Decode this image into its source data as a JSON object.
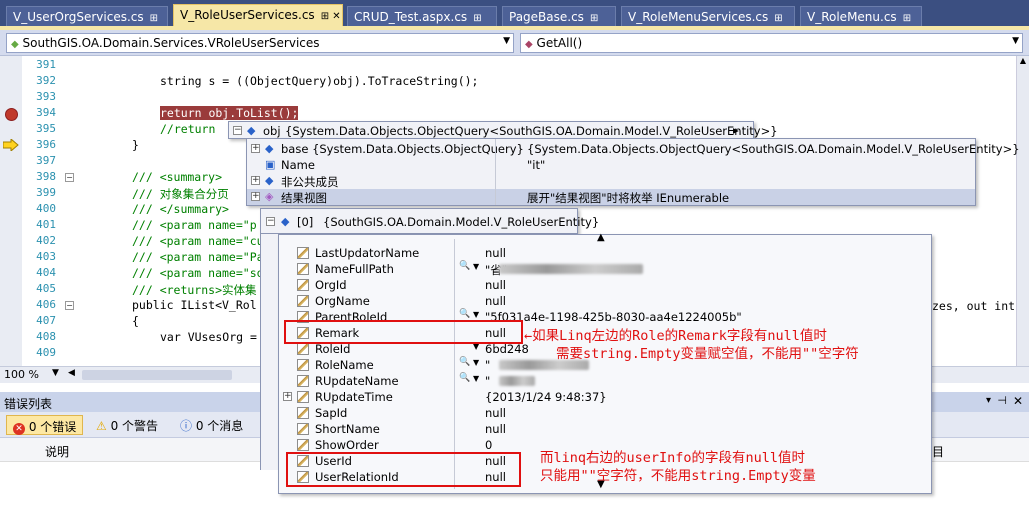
{
  "tabs": [
    {
      "label": "V_UserOrgServices.cs",
      "active": false
    },
    {
      "label": "V_RoleUserServices.cs",
      "active": true
    },
    {
      "label": "CRUD_Test.aspx.cs",
      "active": false
    },
    {
      "label": "PageBase.cs",
      "active": false
    },
    {
      "label": "V_RoleMenuServices.cs",
      "active": false
    },
    {
      "label": "V_RoleMenu.cs",
      "active": false
    }
  ],
  "nav": {
    "class_combo": "SouthGIS.OA.Domain.Services.VRoleUserServices",
    "member_combo": "GetAll()"
  },
  "lines": [
    {
      "n": "391",
      "t": ""
    },
    {
      "n": "392",
      "t": "string s = ((ObjectQuery)obj).ToTraceString();"
    },
    {
      "n": "393",
      "t": ""
    },
    {
      "n": "394",
      "t": "return obj.ToList();"
    },
    {
      "n": "395",
      "t": "//return"
    },
    {
      "n": "396",
      "t": "}"
    },
    {
      "n": "397",
      "t": ""
    },
    {
      "n": "398",
      "t": "/// <summary>"
    },
    {
      "n": "399",
      "t": "/// 对象集合分页"
    },
    {
      "n": "400",
      "t": "/// </summary>"
    },
    {
      "n": "401",
      "t": "/// <param name=\"p"
    },
    {
      "n": "402",
      "t": "/// <param name=\"cu"
    },
    {
      "n": "403",
      "t": "/// <param name=\"Pa"
    },
    {
      "n": "404",
      "t": "/// <param name=\"so"
    },
    {
      "n": "405",
      "t": "/// <returns>实体集"
    },
    {
      "n": "406",
      "t": "public IList<V_Rol"
    },
    {
      "n": "407",
      "t": "{"
    },
    {
      "n": "408",
      "t": "var VUsesOrg = "
    },
    {
      "n": "409",
      "t": ""
    }
  ],
  "code_tail": "zes, out int",
  "zoom": "100 %",
  "error_list": {
    "title": "错误列表",
    "errors": "0 个错误",
    "warnings": "0 个警告",
    "messages": "0 个消息",
    "col_desc": "说明",
    "col_right": "目"
  },
  "tip1": {
    "name": "obj",
    "value": "{System.Data.Objects.ObjectQuery<SouthGIS.OA.Domain.Model.V_RoleUserEntity>}"
  },
  "tip2": [
    {
      "name": "base {System.Data.Objects.ObjectQuery}",
      "value": "{System.Data.Objects.ObjectQuery<SouthGIS.OA.Domain.Model.V_RoleUserEntity>}"
    },
    {
      "name": "Name",
      "value": "\"it\""
    },
    {
      "name": "非公共成员",
      "value": ""
    },
    {
      "name": "结果视图",
      "value": "展开\"结果视图\"时将枚举 IEnumerable"
    }
  ],
  "tip3": {
    "name": "[0]",
    "value": "{SouthGIS.OA.Domain.Model.V_RoleUserEntity}"
  },
  "props": [
    {
      "name": "LastUpdatorName",
      "value": "null"
    },
    {
      "name": "NameFullPath",
      "value": "\"省\"",
      "blur": "xxxxxxxxxxxxxxxx"
    },
    {
      "name": "OrgId",
      "value": "null"
    },
    {
      "name": "OrgName",
      "value": "null"
    },
    {
      "name": "ParentRoleId",
      "value": "\"5f031a4e-1198-425b-8030-aa4e1224005b\""
    },
    {
      "name": "Remark",
      "value": "null"
    },
    {
      "name": "RoleId",
      "value": "6bd248"
    },
    {
      "name": "RoleName",
      "value": "\"",
      "blur": "xxxxxxxxxx"
    },
    {
      "name": "RUpdateName",
      "value": "\"",
      "blur": "xxxx"
    },
    {
      "name": "RUpdateTime",
      "value": "{2013/1/24 9:48:37}"
    },
    {
      "name": "SapId",
      "value": "null"
    },
    {
      "name": "ShortName",
      "value": "null"
    },
    {
      "name": "ShowOrder",
      "value": "0"
    },
    {
      "name": "UserId",
      "value": "null"
    },
    {
      "name": "UserRelationId",
      "value": "null"
    }
  ],
  "annotations": [
    "←如果Linq左边的Role的Remark字段有null值时",
    "需要string.Empty变量赋空值，不能用\"\"空字符",
    "而linq右边的userInfo的字段有null值时",
    "只能用\"\"空字符，不能用string.Empty变量"
  ],
  "colors": {
    "tab_bg": "#3b4f81",
    "active_tab": "#f6e7a7",
    "annotation": "#e01010",
    "breakpoint": "#c0392b"
  }
}
